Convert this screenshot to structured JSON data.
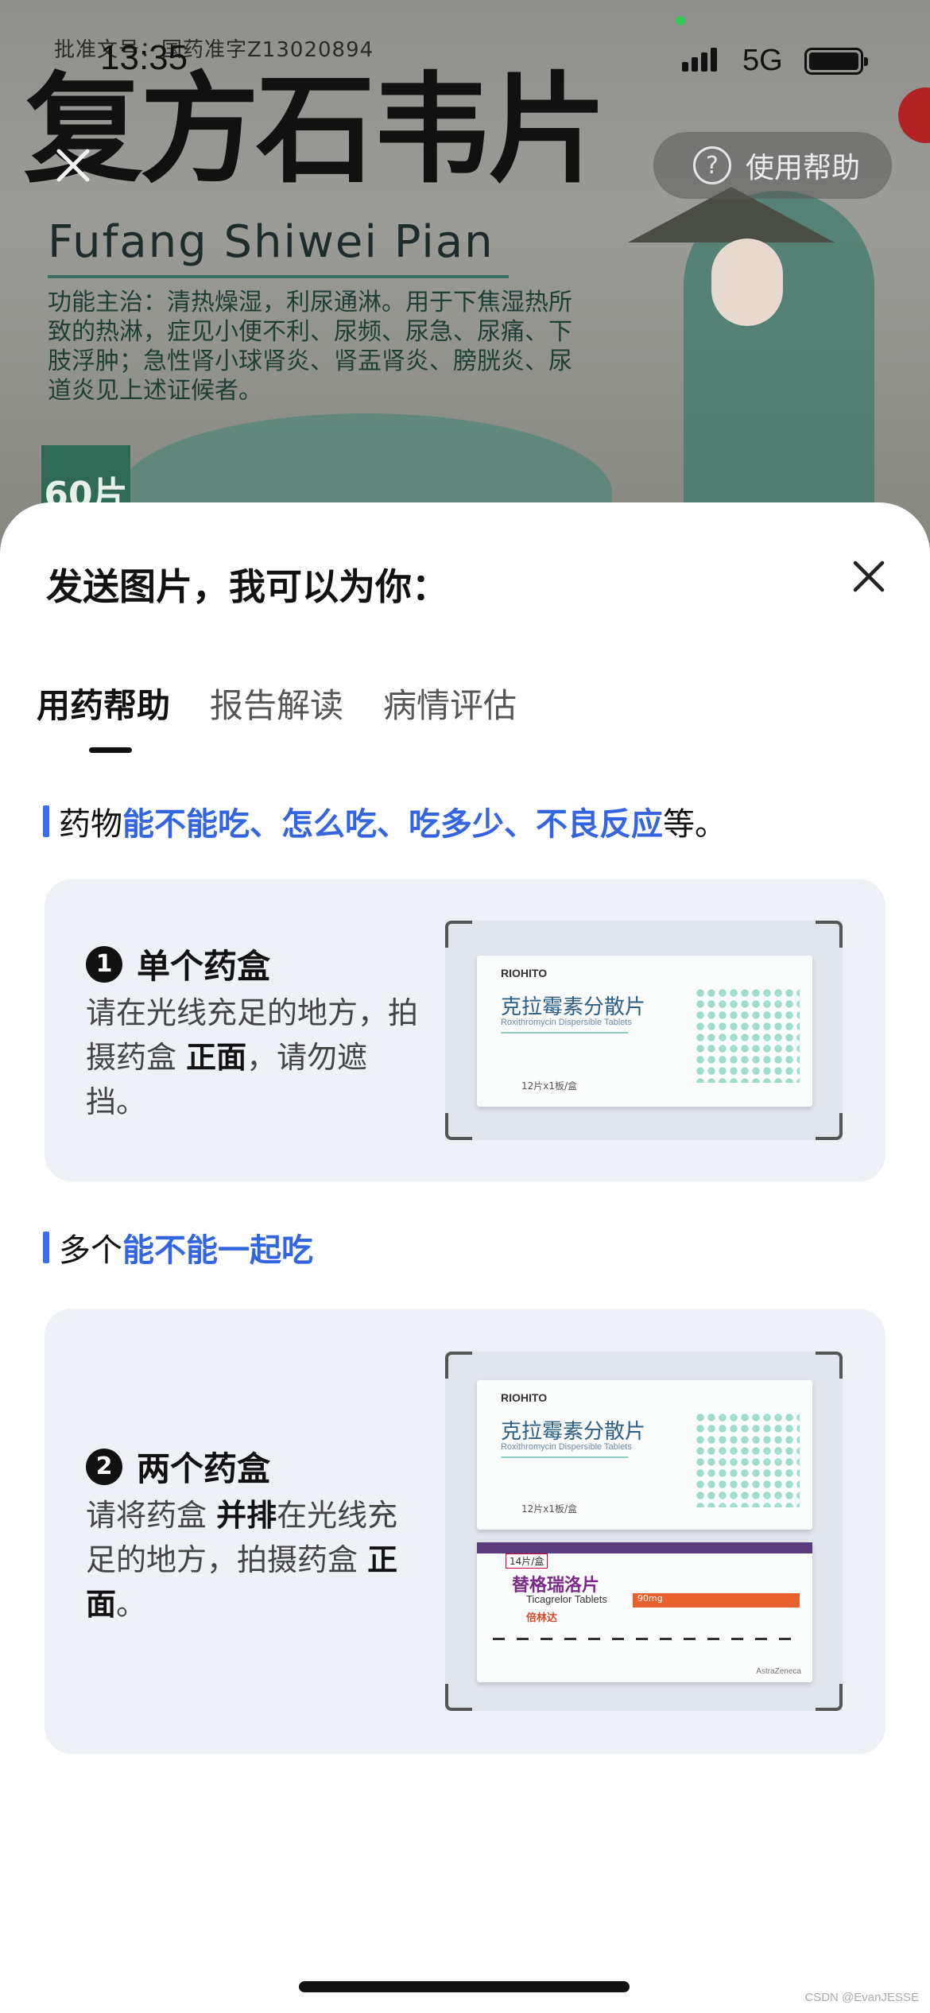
{
  "status_bar": {
    "time": "13:35",
    "network": "5G"
  },
  "camera": {
    "box_approval": "批准文号：国药准字Z13020894",
    "box_title_cn": "复方石韦片",
    "box_title_en": "Fufang Shiwei Pian",
    "box_desc": "功能主治：清热燥湿，利尿通淋。用于下焦湿热所致的热淋，症见小便不利、尿频、尿急、尿痛、下肢浮肿；急性肾小球肾炎、肾盂肾炎、膀胱炎、尿道炎见上述证候者。",
    "box_count": "60片",
    "help_button_label": "使用帮助",
    "help_icon": "?"
  },
  "sheet": {
    "title": "发送图片，我可以为你：",
    "tabs": [
      {
        "label": "用药帮助",
        "active": true
      },
      {
        "label": "报告解读",
        "active": false
      },
      {
        "label": "病情评估",
        "active": false
      }
    ],
    "section1": {
      "prefix": "药物",
      "highlight": "能不能吃、怎么吃、吃多少、不良反应",
      "suffix": "等。"
    },
    "card1": {
      "number": "1",
      "title": "单个药盒",
      "desc_a": "请在光线充足的地方，拍摄药盒 ",
      "desc_bold": "正面",
      "desc_b": "，请勿遮挡。"
    },
    "section2": {
      "prefix": "多个",
      "highlight": "能不能一起吃"
    },
    "card2": {
      "number": "2",
      "title": "两个药盒",
      "desc_a": "请将药盒 ",
      "desc_bold1": "并排",
      "desc_b": "在光线充足的地方，拍摄药盒 ",
      "desc_bold2": "正面",
      "desc_c": "。"
    },
    "sample_box1": {
      "brand": "RIOHITO",
      "name": "克拉霉素分散片",
      "name_en": "Roxithromycin Dispersible Tablets",
      "qty": "12片x1板/盒"
    },
    "sample_box2": {
      "tag": "14片/盒",
      "name": "替格瑞洛片",
      "name_en": "Ticagrelor Tablets",
      "brand": "倍林达",
      "dose": "90mg",
      "maker": "AstraZeneca"
    }
  },
  "watermark": "CSDN @EvanJESSE",
  "colors": {
    "accent_blue": "#3464e0",
    "sheet_bg": "#ffffff",
    "card_bg": "#eef1f5"
  }
}
